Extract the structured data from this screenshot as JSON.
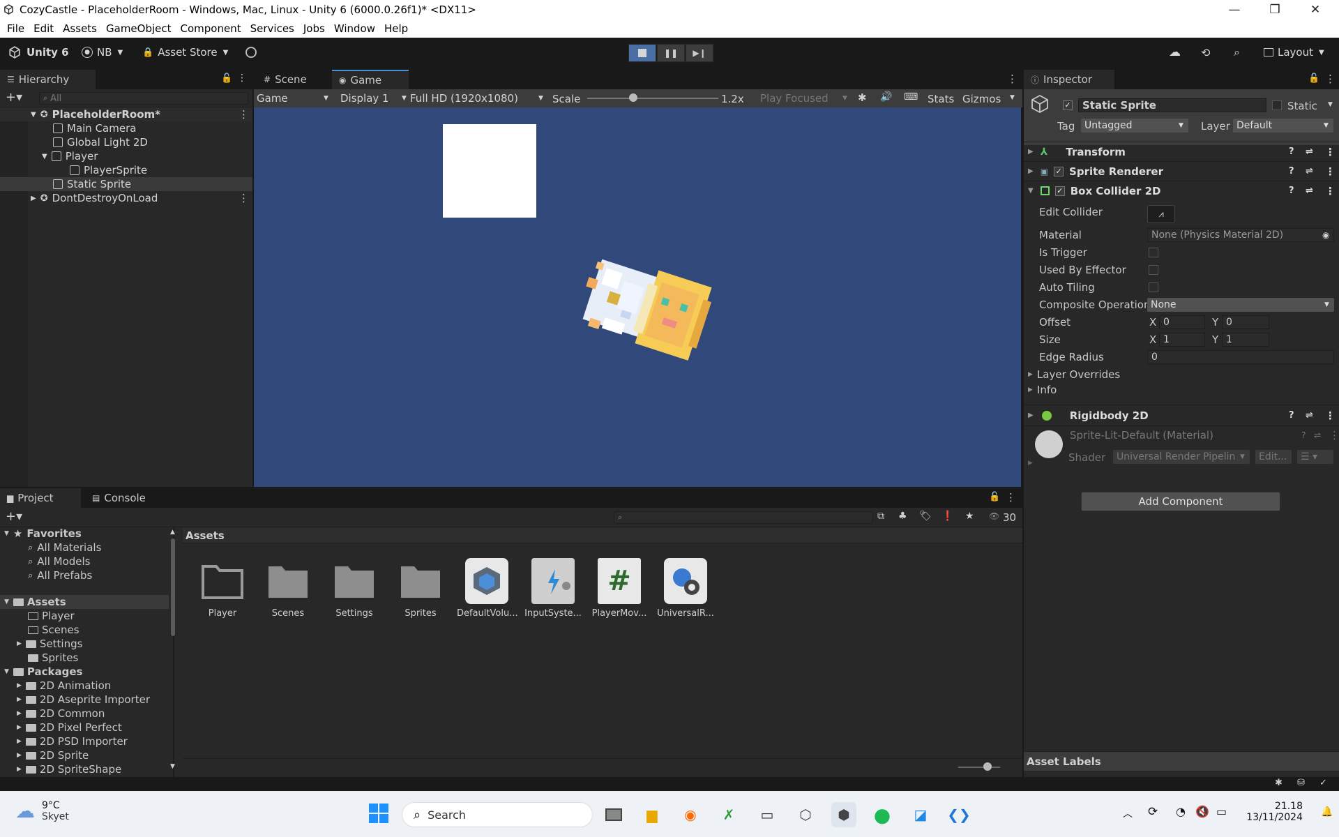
{
  "window": {
    "title": "CozyCastle - PlaceholderRoom - Windows, Mac, Linux - Unity 6 (6000.0.26f1)* <DX11>",
    "minimize": "—",
    "restore": "❐",
    "close": "✕"
  },
  "menu": [
    "File",
    "Edit",
    "Assets",
    "GameObject",
    "Component",
    "Services",
    "Jobs",
    "Window",
    "Help"
  ],
  "toolbar": {
    "unity_label": "Unity 6",
    "account": "NB",
    "asset_store": "Asset Store",
    "layout": "Layout"
  },
  "hierarchy": {
    "tab": "Hierarchy",
    "search_placeholder": "All",
    "scene": "PlaceholderRoom*",
    "items": [
      "Main Camera",
      "Global Light 2D",
      "Player",
      "PlayerSprite",
      "Static Sprite"
    ],
    "dontdestroy": "DontDestroyOnLoad"
  },
  "game": {
    "tab_scene": "Scene",
    "tab_game": "Game",
    "mode": "Game",
    "display": "Display 1",
    "resolution": "Full HD (1920x1080)",
    "scale_label": "Scale",
    "scale_value": "1.2x",
    "scale_fraction": 0.35,
    "play_focused": "Play Focused",
    "stats": "Stats",
    "gizmos": "Gizmos",
    "bg_color": "#31497a"
  },
  "inspector": {
    "tab": "Inspector",
    "object_name": "Static Sprite",
    "static_label": "Static",
    "tag_label": "Tag",
    "tag_value": "Untagged",
    "layer_label": "Layer",
    "layer_value": "Default",
    "components": {
      "transform": "Transform",
      "sprite_renderer": "Sprite Renderer",
      "box_collider": "Box Collider 2D",
      "rigidbody": "Rigidbody 2D"
    },
    "collider": {
      "edit_collider": "Edit Collider",
      "material_label": "Material",
      "material_value": "None (Physics Material 2D)",
      "is_trigger": "Is Trigger",
      "used_by_effector": "Used By Effector",
      "auto_tiling": "Auto Tiling",
      "composite_label": "Composite Operation",
      "composite_value": "None",
      "offset_label": "Offset",
      "offset_x": "0",
      "offset_y": "0",
      "size_label": "Size",
      "size_x": "1",
      "size_y": "1",
      "x": "X",
      "y": "Y",
      "edge_radius_label": "Edge Radius",
      "edge_radius_value": "0",
      "layer_overrides": "Layer Overrides",
      "info": "Info"
    },
    "material": {
      "name": "Sprite-Lit-Default (Material)",
      "shader_label": "Shader",
      "shader_value": "Universal Render Pipelin",
      "edit": "Edit..."
    },
    "add_component": "Add Component",
    "asset_labels": "Asset Labels"
  },
  "project": {
    "tab_project": "Project",
    "tab_console": "Console",
    "count": "30",
    "favorites": "Favorites",
    "fav_items": [
      "All Materials",
      "All Models",
      "All Prefabs"
    ],
    "assets_root": "Assets",
    "asset_folders": [
      "Player",
      "Scenes",
      "Settings",
      "Sprites"
    ],
    "packages": "Packages",
    "package_items": [
      "2D Animation",
      "2D Aseprite Importer",
      "2D Common",
      "2D Pixel Perfect",
      "2D PSD Importer",
      "2D Sprite",
      "2D SpriteShape"
    ],
    "breadcrumb": "Assets",
    "grid": [
      {
        "label": "Player",
        "icon": "folder-icon"
      },
      {
        "label": "Scenes",
        "icon": "folder-icon"
      },
      {
        "label": "Settings",
        "icon": "folder-icon"
      },
      {
        "label": "Sprites",
        "icon": "folder-icon"
      },
      {
        "label": "DefaultVolu...",
        "icon": "volume-profile-icon"
      },
      {
        "label": "InputSyste...",
        "icon": "input-actions-icon"
      },
      {
        "label": "PlayerMov...",
        "icon": "csharp-script-icon"
      },
      {
        "label": "UniversalR...",
        "icon": "render-pipeline-asset-icon"
      }
    ]
  },
  "taskbar": {
    "weather_temp": "9°C",
    "weather_desc": "Skyet",
    "search": "Search",
    "time": "21.18",
    "date": "13/11/2024"
  }
}
